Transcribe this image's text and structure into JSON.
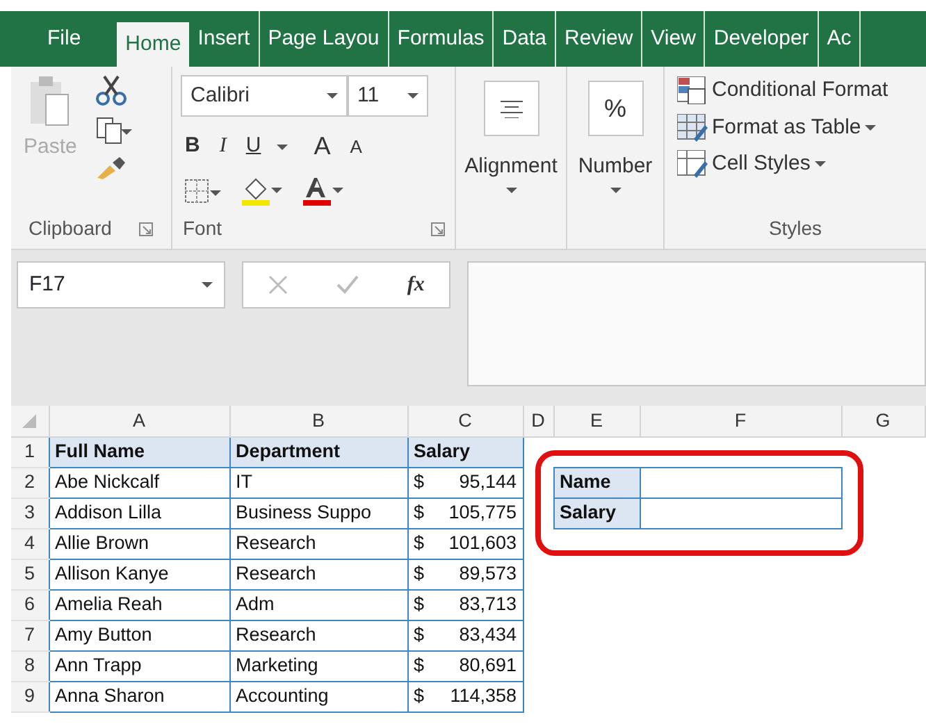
{
  "tabs": [
    {
      "label": "File",
      "selected": false
    },
    {
      "label": "Home",
      "selected": true
    },
    {
      "label": "Insert",
      "selected": false
    },
    {
      "label": "Page Layou",
      "selected": false
    },
    {
      "label": "Formulas",
      "selected": false
    },
    {
      "label": "Data",
      "selected": false
    },
    {
      "label": "Review",
      "selected": false
    },
    {
      "label": "View",
      "selected": false
    },
    {
      "label": "Developer",
      "selected": false
    },
    {
      "label": "Ac",
      "selected": false
    }
  ],
  "ribbon": {
    "clipboard": {
      "paste": {
        "label": "Paste",
        "disabled": true
      },
      "group_label": "Clipboard"
    },
    "font": {
      "font_name": "Calibri",
      "font_size": "11",
      "bold": "B",
      "italic": "I",
      "underline": "U",
      "grow": "A",
      "shrink": "A",
      "group_label": "Font"
    },
    "alignment": {
      "label": "Alignment"
    },
    "number": {
      "symbol": "%",
      "label": "Number"
    },
    "styles": {
      "items": [
        {
          "label": "Conditional Format",
          "dropdown": false
        },
        {
          "label": "Format as Table",
          "dropdown": true
        },
        {
          "label": "Cell Styles",
          "dropdown": true
        }
      ],
      "group_label": "Styles"
    }
  },
  "formula_bar": {
    "name_box": "F17",
    "function_label": "fx"
  },
  "grid": {
    "columns": [
      "A",
      "B",
      "C",
      "D",
      "E",
      "F",
      "G"
    ],
    "rows": [
      {
        "number": "1",
        "name": "Full Name",
        "department": "Department",
        "salary": "Salary",
        "header": true
      },
      {
        "number": "2",
        "name": "Abe Nickcalf",
        "department": "IT",
        "currency": "$",
        "amount": "95,144",
        "header": false
      },
      {
        "number": "3",
        "name": "Addison Lilla",
        "department": "Business Suppo",
        "currency": "$",
        "amount": "105,775",
        "header": false
      },
      {
        "number": "4",
        "name": "Allie Brown",
        "department": "Research",
        "currency": "$",
        "amount": "101,603",
        "header": false
      },
      {
        "number": "5",
        "name": "Allison Kanye",
        "department": "Research",
        "currency": "$",
        "amount": "89,573",
        "header": false
      },
      {
        "number": "6",
        "name": "Amelia Reah",
        "department": "Adm",
        "currency": "$",
        "amount": "83,713",
        "header": false
      },
      {
        "number": "7",
        "name": "Amy Button",
        "department": "Research",
        "currency": "$",
        "amount": "83,434",
        "header": false
      },
      {
        "number": "8",
        "name": "Ann Trapp",
        "department": "Marketing",
        "currency": "$",
        "amount": "80,691",
        "header": false
      },
      {
        "number": "9",
        "name": "Anna Sharon",
        "department": "Accounting",
        "currency": "$",
        "amount": "114,358",
        "header": false
      }
    ]
  },
  "lookup": {
    "labels": [
      "Name",
      "Salary"
    ],
    "annotation": {
      "kind": "outline"
    }
  }
}
